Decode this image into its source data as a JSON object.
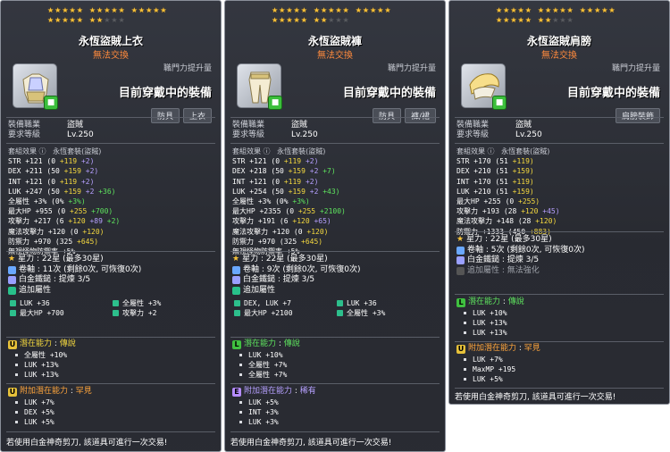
{
  "panels": [
    {
      "name": "永恆盜賊上衣",
      "trade": "無法交換",
      "ability_label": "職門力提升量",
      "equipped": "目前穿戴中的裝備",
      "categories": [
        "防具",
        "上衣"
      ],
      "req_job_label": "裝備職業",
      "req_job": "盜賊",
      "req_level_label": "要求等級",
      "req_level": "Lv.250",
      "set_label": "套組效果",
      "set_name": "永恆套裝(盜賊)",
      "stats": [
        [
          "STR",
          "+121",
          "(0",
          "+119",
          "+2)"
        ],
        [
          "DEX",
          "+211",
          "(50",
          "+159",
          "+2)"
        ],
        [
          "INT",
          "+121",
          "(0",
          "+119",
          "+2)"
        ],
        [
          "LUK",
          "+247",
          "(50",
          "+159",
          "+2",
          "+36)"
        ]
      ],
      "allstat": [
        "全屬性",
        "+3%",
        "(0%",
        "+3%)"
      ],
      "maxhp": [
        "最大HP",
        "+955",
        "(0",
        "+255",
        "+700)"
      ],
      "atk": [
        "攻擊力",
        "+217",
        "(6",
        "+120",
        "+89",
        "+2)"
      ],
      "matk": [
        "魔法攻擊力",
        "+120",
        "(0",
        "+120)"
      ],
      "def": [
        "防禦力",
        "+970",
        "(325",
        "+645)"
      ],
      "ignore": [
        "無視怪物防禦率",
        "+5%"
      ],
      "starforce": "星力 : 22星 (最多30星)",
      "scroll": "卷軸 : 11次 (剩餘0次, 可恢復0次)",
      "hammer": "白金鐵鎚 : 提煉 3/5",
      "add_label": "追加屬性",
      "add": [
        [
          "LUK",
          "+36"
        ],
        [
          "全屬性",
          "+3%"
        ],
        [
          "最大HP",
          "+700"
        ],
        [
          "攻擊力",
          "+2"
        ]
      ],
      "pot_label": "潛在能力",
      "pot_tier": "傳說",
      "pot": [
        "全屬性 +10%",
        "LUK +13%",
        "LUK +13%"
      ],
      "addpot_label": "附加潛在能力",
      "addpot_tier": "罕見",
      "addpot": [
        "LUK +7%",
        "DEX +5%",
        "LUK +5%"
      ],
      "footer": "若使用白金神奇剪刀, 該道具可進行一次交易!"
    },
    {
      "name": "永恆盜賊褲",
      "trade": "無法交換",
      "ability_label": "職門力提升量",
      "equipped": "目前穿戴中的裝備",
      "categories": [
        "防具",
        "褲/裙"
      ],
      "req_job_label": "裝備職業",
      "req_job": "盜賊",
      "req_level_label": "要求等級",
      "req_level": "Lv.250",
      "set_label": "套組效果",
      "set_name": "永恆套裝(盜賊)",
      "stats": [
        [
          "STR",
          "+121",
          "(0",
          "+119",
          "+2)"
        ],
        [
          "DEX",
          "+218",
          "(50",
          "+159",
          "+2",
          "+7)"
        ],
        [
          "INT",
          "+121",
          "(0",
          "+119",
          "+2)"
        ],
        [
          "LUK",
          "+254",
          "(50",
          "+159",
          "+2",
          "+43)"
        ]
      ],
      "allstat": [
        "全屬性",
        "+3%",
        "(0%",
        "+3%)"
      ],
      "maxhp": [
        "最大HP",
        "+2355",
        "(0",
        "+255",
        "+2100)"
      ],
      "atk": [
        "攻擊力",
        "+191",
        "(6",
        "+120",
        "+65)"
      ],
      "matk": [
        "魔法攻擊力",
        "+120",
        "(0",
        "+120)"
      ],
      "def": [
        "防禦力",
        "+970",
        "(325",
        "+645)"
      ],
      "ignore": [
        "無視怪物防禦率",
        "+5%"
      ],
      "starforce": "星力 : 22星 (最多30星)",
      "scroll": "卷軸 : 9次 (剩餘0次, 可恢復0次)",
      "hammer": "白金鐵鎚 : 提煉 3/5",
      "add_label": "追加屬性",
      "add": [
        [
          "DEX, LUK",
          "+7"
        ],
        [
          "LUK",
          "+36"
        ],
        [
          "最大HP",
          "+2100"
        ],
        [
          "全屬性",
          "+3%"
        ]
      ],
      "pot_label": "潛在能力",
      "pot_tier": "傳說",
      "pot": [
        "LUK +10%",
        "全屬性 +7%",
        "全屬性 +7%"
      ],
      "addpot_label": "附加潛在能力",
      "addpot_tier": "稀有",
      "addpot": [
        "LUK +5%",
        "INT +3%",
        "LUK +3%"
      ],
      "footer": "若使用白金神奇剪刀, 該道具可進行一次交易!"
    },
    {
      "name": "永恆盜賊肩膀",
      "trade": "無法交換",
      "ability_label": "職門力提升量",
      "equipped": "目前穿戴中的裝備",
      "categories": [
        "肩膀裝飾"
      ],
      "req_job_label": "裝備職業",
      "req_job": "盜賊",
      "req_level_label": "要求等級",
      "req_level": "Lv.250",
      "set_label": "套組效果",
      "set_name": "永恆套裝(盜賊)",
      "stats": [
        [
          "STR",
          "+170",
          "(51",
          "+119)"
        ],
        [
          "DEX",
          "+210",
          "(51",
          "+159)"
        ],
        [
          "INT",
          "+170",
          "(51",
          "+119)"
        ],
        [
          "LUK",
          "+210",
          "(51",
          "+159)"
        ]
      ],
      "maxhp": [
        "最大HP",
        "+255",
        "(0",
        "+255)"
      ],
      "atk": [
        "攻擊力",
        "+193",
        "(28",
        "+120",
        "+45)"
      ],
      "matk": [
        "魔法攻擊力",
        "+148",
        "(28",
        "+120)"
      ],
      "def": [
        "防禦力",
        "+1333",
        "(450",
        "+883)"
      ],
      "starforce": "星力 : 22星 (最多30星)",
      "scroll": "卷軸 : 5次 (剩餘0次, 可恢復0次)",
      "hammer": "白金鐵鎚 : 提煉 3/5",
      "extra": "追加屬性 : 無法強化",
      "pot_label": "潛在能力",
      "pot_tier": "傳說",
      "pot": [
        "LUK +10%",
        "LUK +13%",
        "LUK +13%"
      ],
      "addpot_label": "附加潛在能力",
      "addpot_tier": "罕見",
      "addpot": [
        "LUK +7%",
        "MaxMP +195",
        "LUK +5%"
      ],
      "footer": "若使用白金神奇剪刀, 該道具可進行一次交易!"
    }
  ]
}
